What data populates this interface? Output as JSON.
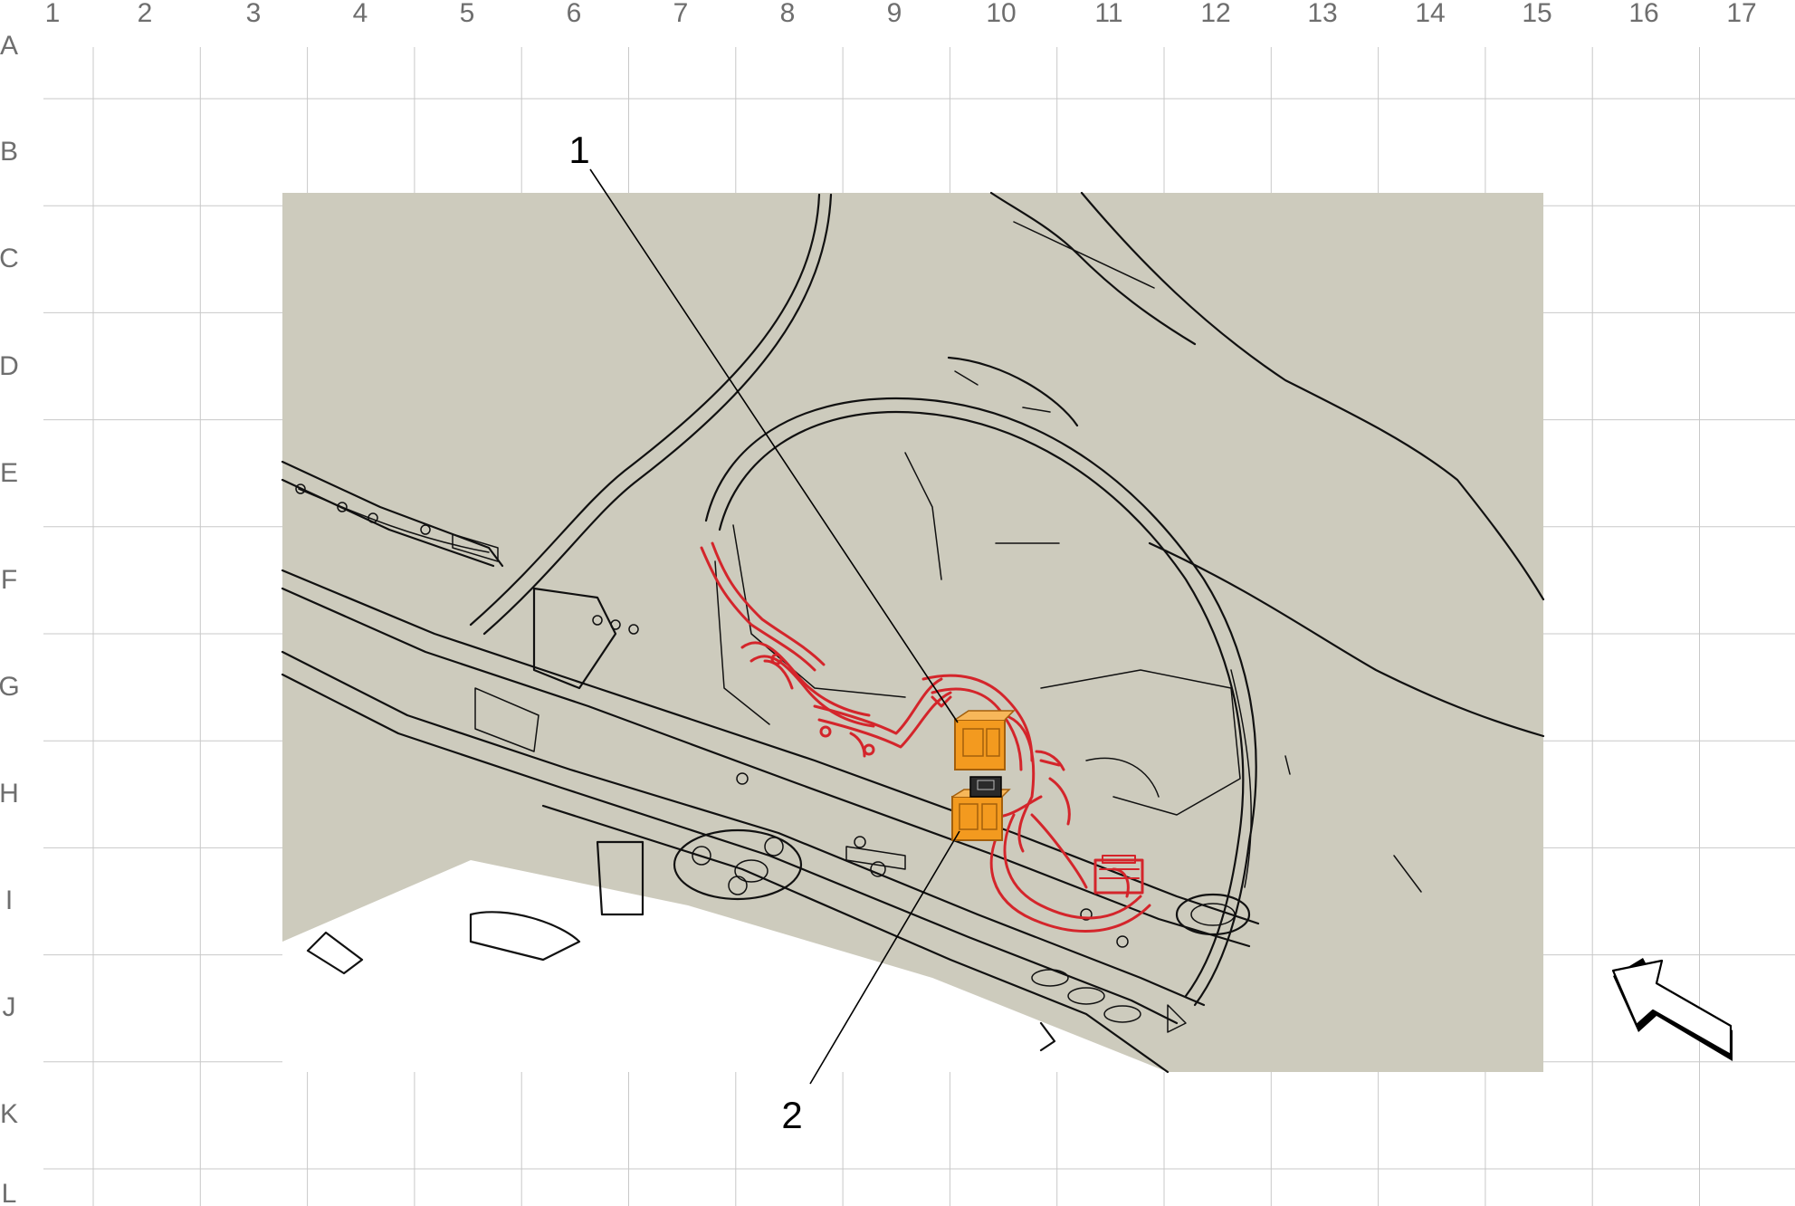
{
  "grid": {
    "columns": [
      "1",
      "2",
      "3",
      "4",
      "5",
      "6",
      "7",
      "8",
      "9",
      "10",
      "11",
      "12",
      "13",
      "14",
      "15",
      "16",
      "17"
    ],
    "rows": [
      "A",
      "B",
      "C",
      "D",
      "E",
      "F",
      "G",
      "H",
      "I",
      "J",
      "K",
      "L"
    ]
  },
  "callouts": [
    {
      "id": "callout-1",
      "label": "1"
    },
    {
      "id": "callout-2",
      "label": "2"
    }
  ],
  "colors": {
    "grid_line": "#c8c8c8",
    "grid_label": "#6e6e6e",
    "background_panel": "#cdcbbd",
    "harness": "#d4252b",
    "module": "#f39a1f",
    "outline": "#111111"
  },
  "icons": {
    "view_direction": "view-direction-arrow-icon"
  }
}
